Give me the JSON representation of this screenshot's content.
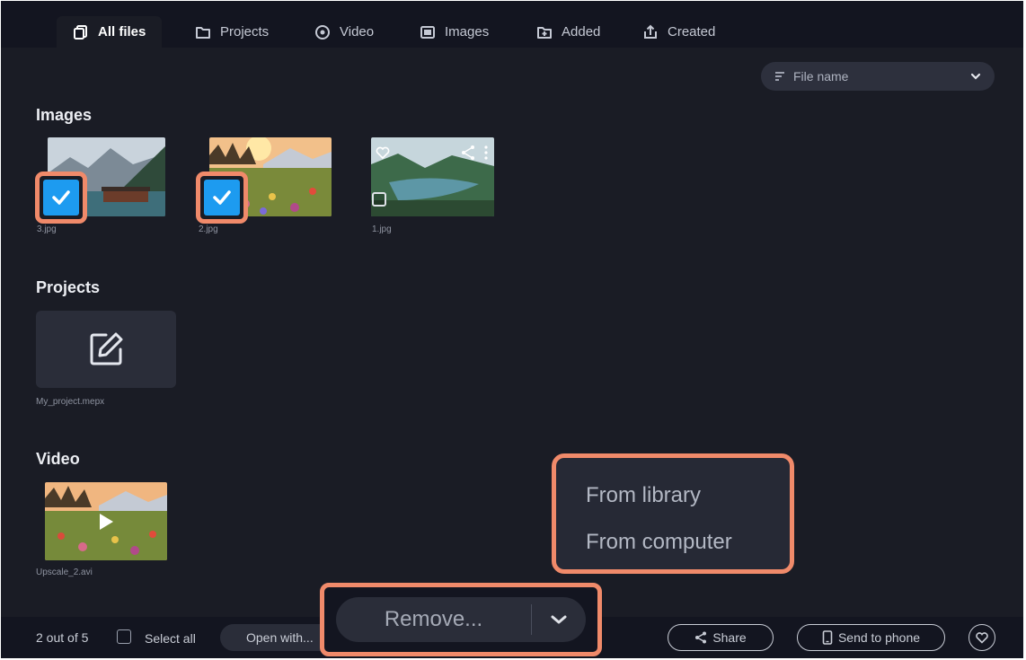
{
  "tabs": [
    {
      "label": "All files",
      "icon": "all-files-icon",
      "active": true
    },
    {
      "label": "Projects",
      "icon": "folder-icon"
    },
    {
      "label": "Video",
      "icon": "play-circle-icon"
    },
    {
      "label": "Images",
      "icon": "image-icon"
    },
    {
      "label": "Added",
      "icon": "added-icon"
    },
    {
      "label": "Created",
      "icon": "export-icon"
    }
  ],
  "sort": {
    "label": "File name",
    "icon": "sort-icon"
  },
  "sections": {
    "images": {
      "title": "Images",
      "items": [
        {
          "name": "3.jpg",
          "checked": true
        },
        {
          "name": "2.jpg",
          "checked": true
        },
        {
          "name": "1.jpg",
          "checked": false
        }
      ]
    },
    "projects": {
      "title": "Projects",
      "items": [
        {
          "name": "My_project.mepx"
        }
      ]
    },
    "video": {
      "title": "Video",
      "items": [
        {
          "name": "Upscale_2.avi"
        }
      ]
    }
  },
  "popup_menu": {
    "items": [
      "From library",
      "From computer"
    ]
  },
  "bottom": {
    "count": "2 out of 5",
    "select_all": "Select all",
    "open_with": "Open with...",
    "remove": "Remove...",
    "share": "Share",
    "send_to_phone": "Send to phone"
  },
  "colors": {
    "accent": "#1d9bf0",
    "highlight": "#f08a6a",
    "background": "#1a1c25"
  }
}
